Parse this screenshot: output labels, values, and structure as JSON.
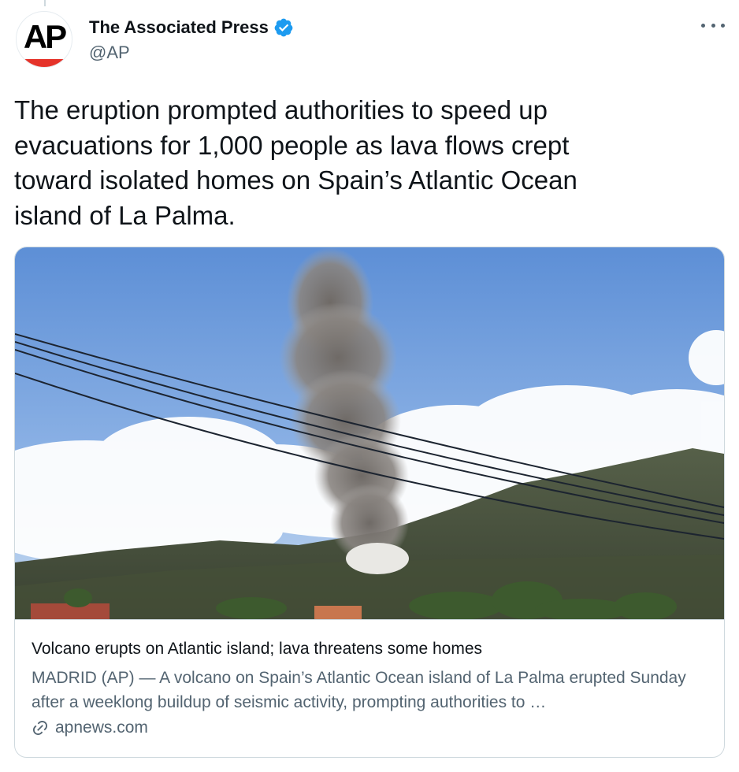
{
  "tweet": {
    "author": {
      "display_name": "The Associated Press",
      "handle": "@AP",
      "avatar_text": "AP",
      "verified": true
    },
    "text": "The eruption prompted authorities to speed up\nevacuations for 1,000 people as lava flows crept\ntoward isolated homes on Spain’s Atlantic Ocean\nisland of La Palma.",
    "card": {
      "title": "Volcano erupts on Atlantic island; lava threatens some homes",
      "description": "MADRID (AP) — A volcano on Spain’s Atlantic Ocean island of La Palma erupted Sunday after a weeklong buildup of seismic activity, prompting authorities to …",
      "domain": "apnews.com"
    }
  },
  "icons": {
    "verified": "verified-badge-icon",
    "more": "more-options-icon",
    "link": "link-icon"
  },
  "colors": {
    "text": "#0f1419",
    "secondary": "#536471",
    "verified": "#1d9bf0",
    "border": "#cfd9de",
    "ap_red": "#e5332a"
  }
}
